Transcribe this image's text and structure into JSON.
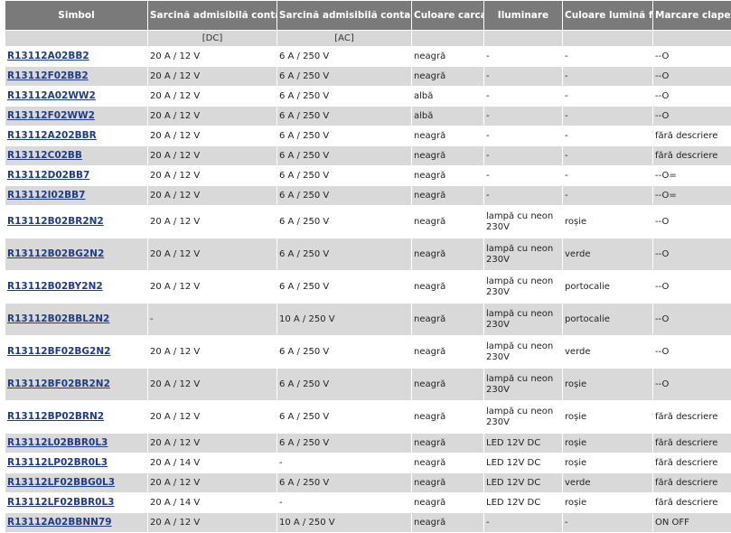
{
  "header": {
    "col_symbol": "Simbol",
    "col_dc": "Sarcină admisibilă contacte DC*",
    "col_ac": "Sarcină admisibilă contacte AC**",
    "col_color": "Culoare carcasă",
    "col_light": "Iluminare",
    "col_bg_light": "Culoare lumină fundal",
    "col_marking": "Marcare clapetă",
    "unit_dc": "[DC]",
    "unit_ac": "[AC]"
  },
  "rows": [
    {
      "symbol": "R13112A02BB2",
      "dc": "20 A / 12 V",
      "ac": "6 A / 250 V",
      "color": "neagră",
      "light": "-",
      "bg": "-",
      "mark": "--O"
    },
    {
      "symbol": "R13112F02BB2",
      "dc": "20 A / 12 V",
      "ac": "6 A / 250 V",
      "color": "neagră",
      "light": "-",
      "bg": "-",
      "mark": "--O"
    },
    {
      "symbol": "R13112A02WW2",
      "dc": "20 A / 12 V",
      "ac": "6 A / 250 V",
      "color": "albă",
      "light": "-",
      "bg": "-",
      "mark": "--O"
    },
    {
      "symbol": "R13112F02WW2",
      "dc": "20 A / 12 V",
      "ac": "6 A / 250 V",
      "color": "albă",
      "light": "-",
      "bg": "-",
      "mark": "--O"
    },
    {
      "symbol": "R13112A202BBR",
      "dc": "20 A / 12 V",
      "ac": "6 A / 250 V",
      "color": "neagră",
      "light": "-",
      "bg": "-",
      "mark": "fără descriere"
    },
    {
      "symbol": "R13112C02BB",
      "dc": "20 A / 12 V",
      "ac": "6 A / 250 V",
      "color": "neagră",
      "light": "-",
      "bg": "-",
      "mark": "fără descriere"
    },
    {
      "symbol": "R13112D02BB7",
      "dc": "20 A / 12 V",
      "ac": "6 A / 250 V",
      "color": "neagră",
      "light": "-",
      "bg": "-",
      "mark": "--O="
    },
    {
      "symbol": "R13112I02BB7",
      "dc": "20 A / 12 V",
      "ac": "6 A / 250 V",
      "color": "neagră",
      "light": "-",
      "bg": "-",
      "mark": "--O="
    },
    {
      "symbol": "R13112B02BR2N2",
      "dc": "20 A / 12 V",
      "ac": "6 A / 250 V",
      "color": "neagră",
      "light": "lampă cu neon 230V",
      "bg": "roșie",
      "mark": "--O"
    },
    {
      "symbol": "R13112B02BG2N2",
      "dc": "20 A / 12 V",
      "ac": "6 A / 250 V",
      "color": "neagră",
      "light": "lampă cu neon 230V",
      "bg": "verde",
      "mark": "--O"
    },
    {
      "symbol": "R13112B02BY2N2",
      "dc": "20 A / 12 V",
      "ac": "6 A / 250 V",
      "color": "neagră",
      "light": "lampă cu neon 230V",
      "bg": "portocalie",
      "mark": "--O"
    },
    {
      "symbol": "R13112B02BBL2N2",
      "dc": "-",
      "ac": "10 A / 250 V",
      "color": "neagră",
      "light": "lampă cu neon 230V",
      "bg": "portocalie",
      "mark": "--O"
    },
    {
      "symbol": "R13112BF02BG2N2",
      "dc": "20 A / 12 V",
      "ac": "6 A / 250 V",
      "color": "neagră",
      "light": "lampă cu neon 230V",
      "bg": "verde",
      "mark": "--O"
    },
    {
      "symbol": "R13112BF02BR2N2",
      "dc": "20 A / 12 V",
      "ac": "6 A / 250 V",
      "color": "neagră",
      "light": "lampă cu neon 230V",
      "bg": "roșie",
      "mark": "--O"
    },
    {
      "symbol": "R13112BP02BRN2",
      "dc": "20 A / 12 V",
      "ac": "6 A / 250 V",
      "color": "neagră",
      "light": "lampă cu neon 230V",
      "bg": "roșie",
      "mark": "fără descriere"
    },
    {
      "symbol": "R13112L02BBR0L3",
      "dc": "20 A / 12 V",
      "ac": "6 A / 250 V",
      "color": "neagră",
      "light": "LED 12V DC",
      "bg": "roșie",
      "mark": "fără descriere"
    },
    {
      "symbol": "R13112LP02BR0L3",
      "dc": "20 A / 14 V",
      "ac": "-",
      "color": "neagră",
      "light": "LED 12V DC",
      "bg": "roșie",
      "mark": "fără descriere"
    },
    {
      "symbol": "R13112LF02BBG0L3",
      "dc": "20 A / 12 V",
      "ac": "6 A / 250 V",
      "color": "neagră",
      "light": "LED 12V DC",
      "bg": "verde",
      "mark": "fără descriere"
    },
    {
      "symbol": "R13112LF02BBR0L3",
      "dc": "20 A / 14 V",
      "ac": "-",
      "color": "neagră",
      "light": "LED 12V DC",
      "bg": "roșie",
      "mark": "fără descriere"
    },
    {
      "symbol": "R13112A02BBNN79",
      "dc": "20 A / 12 V",
      "ac": "10 A / 250 V",
      "color": "neagră",
      "light": "-",
      "bg": "-",
      "mark": "ON OFF"
    }
  ],
  "colors": {
    "header_bg": "#7a7a7a",
    "subheader_bg": "#d7d7d7",
    "row_even_bg": "#d9d9d9",
    "link": "#1f3b8c"
  }
}
